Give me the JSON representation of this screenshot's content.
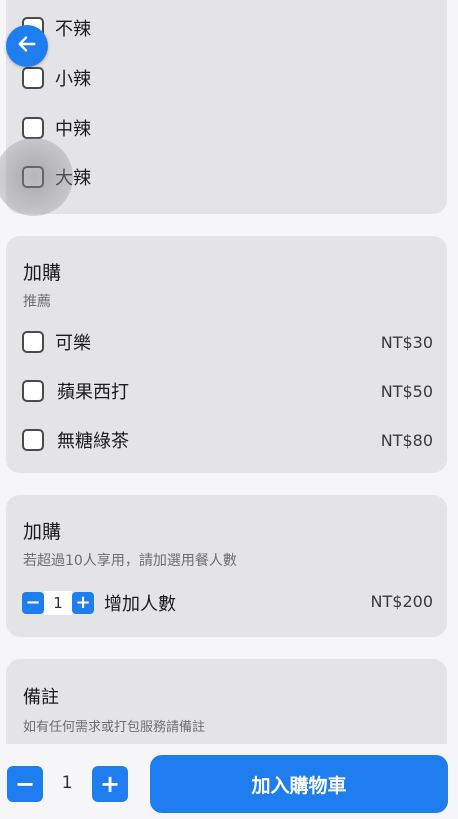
{
  "spice": {
    "options": [
      {
        "label": "不辣"
      },
      {
        "label": "小辣"
      },
      {
        "label": "中辣"
      },
      {
        "label": "大辣"
      }
    ]
  },
  "addon1": {
    "title": "加購",
    "subtitle": "推薦",
    "items": [
      {
        "label": "可樂",
        "price": "NT$30"
      },
      {
        "label": "蘋果西打",
        "price": "NT$50"
      },
      {
        "label": "無糖綠茶",
        "price": "NT$80"
      }
    ]
  },
  "addon2": {
    "title": "加購",
    "subtitle": "若超過10人享用，請加選用餐人數",
    "minus": "−",
    "plus": "+",
    "quantity": "1",
    "label": "增加人數",
    "price": "NT$200"
  },
  "notes": {
    "title": "備註",
    "subtitle": "如有任何需求或打包服務請備註"
  },
  "footer": {
    "minus": "−",
    "plus": "+",
    "quantity": "1",
    "cart_label": "加入購物車"
  },
  "icons": {
    "back": "arrow-left-icon"
  },
  "colors": {
    "accent": "#1e7ef0",
    "card": "#e4e3e6",
    "background": "#f6f5f8"
  }
}
